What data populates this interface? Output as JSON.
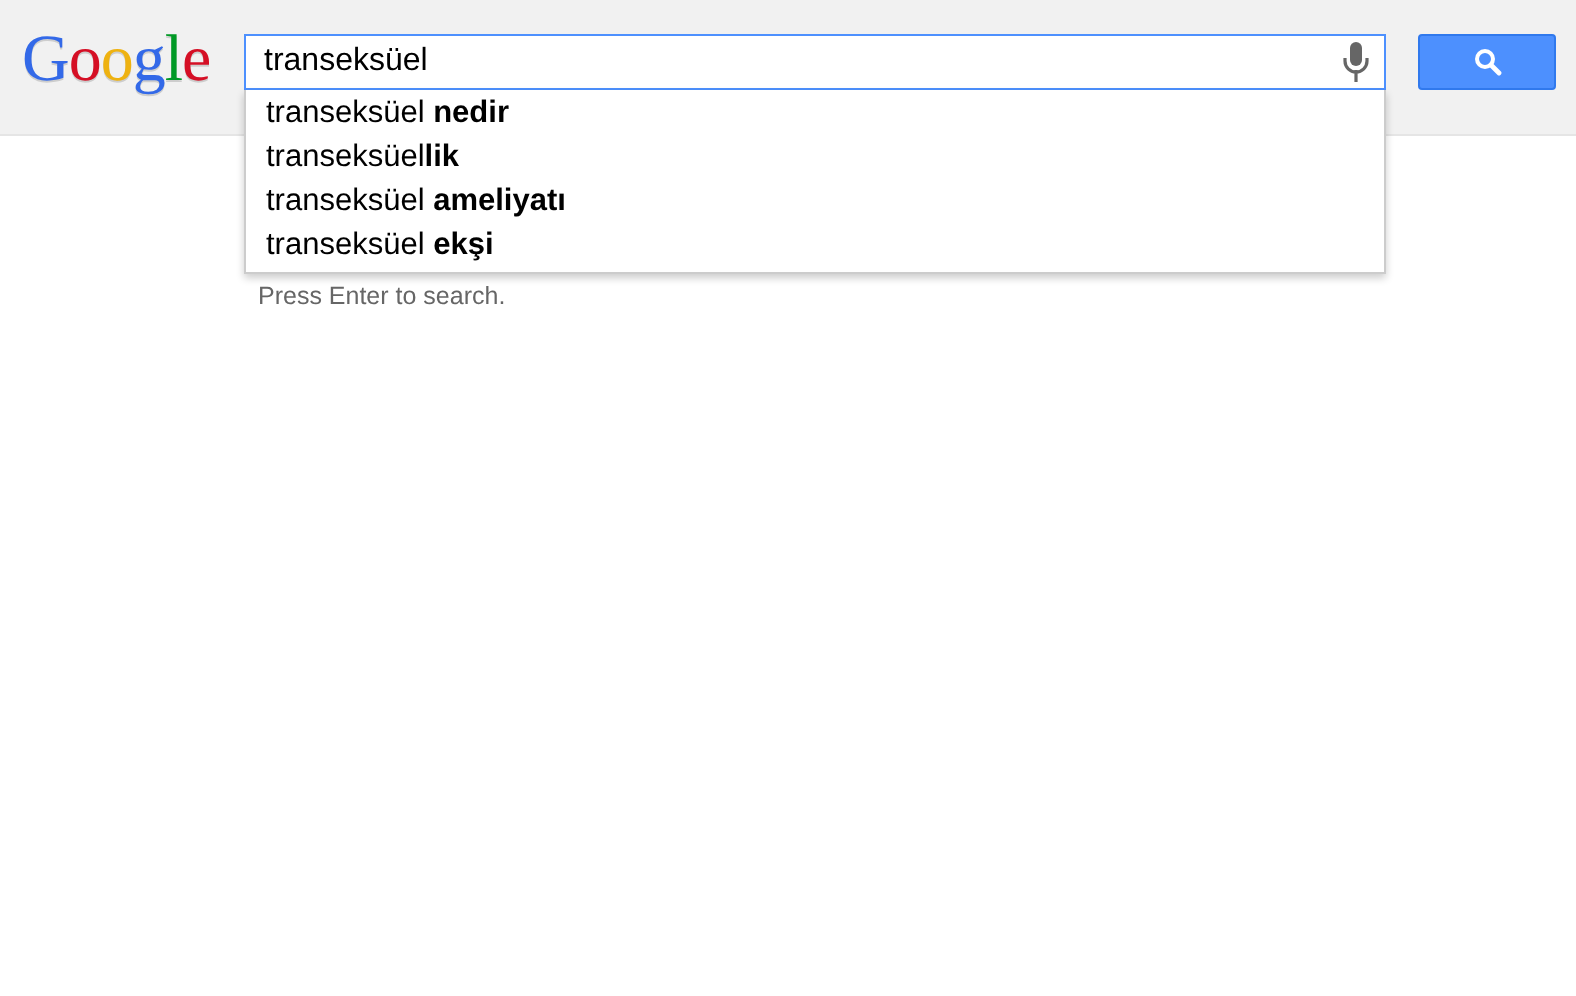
{
  "logo": [
    {
      "letter": "G",
      "color": "#3369e8"
    },
    {
      "letter": "o",
      "color": "#d50f25"
    },
    {
      "letter": "o",
      "color": "#eeb211"
    },
    {
      "letter": "g",
      "color": "#3369e8"
    },
    {
      "letter": "l",
      "color": "#009925"
    },
    {
      "letter": "e",
      "color": "#d50f25"
    }
  ],
  "search": {
    "value": "transeksüel"
  },
  "suggestions": [
    "transeksüel **nedir**",
    "transeksüel**lik**",
    "transeksüel **ameliyatı**",
    "transeksüel **ekşi**"
  ],
  "hint": "Press Enter to search."
}
